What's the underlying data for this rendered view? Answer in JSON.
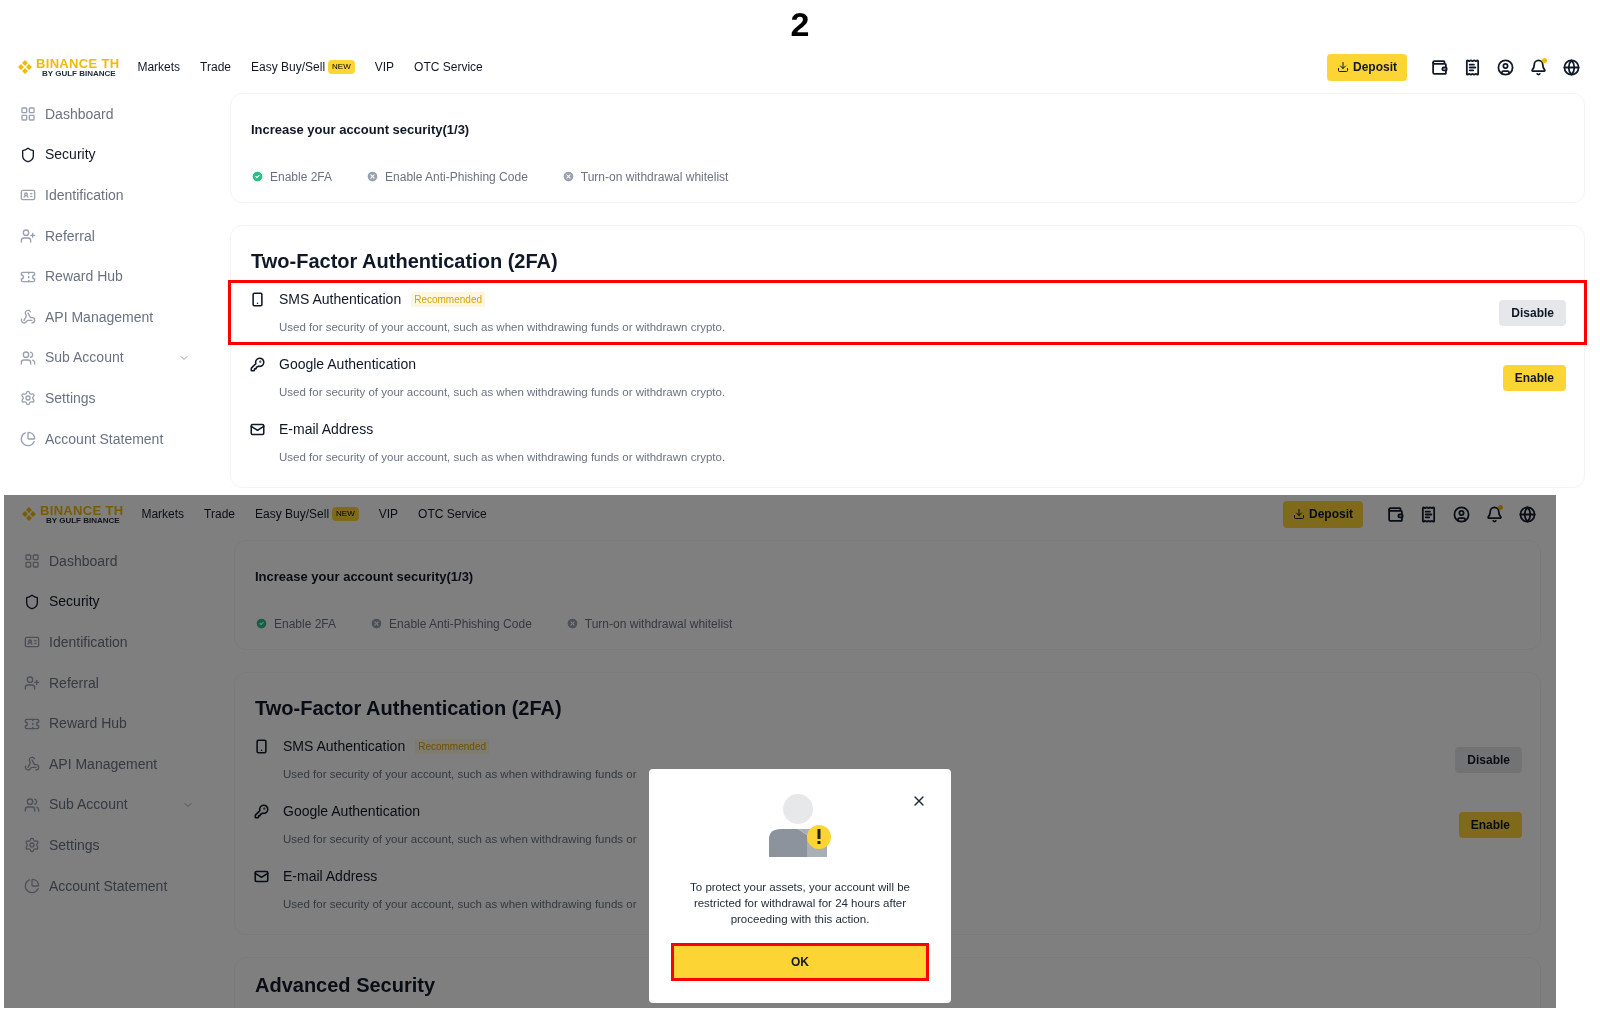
{
  "step_label": "2",
  "screens": [
    {
      "dimmed": false,
      "logo": {
        "name": "BINANCE TH",
        "sub": "BY GULF BINANCE"
      },
      "nav": [
        {
          "label": "Markets"
        },
        {
          "label": "Trade"
        },
        {
          "label": "Easy Buy/Sell",
          "badge": "NEW"
        },
        {
          "label": "VIP"
        },
        {
          "label": "OTC Service"
        }
      ],
      "deposit": "Deposit",
      "sidebar": [
        {
          "label": "Dashboard",
          "selected": false,
          "submenu": false
        },
        {
          "label": "Security",
          "selected": true,
          "submenu": false
        },
        {
          "label": "Identification",
          "selected": false,
          "submenu": false
        },
        {
          "label": "Referral",
          "selected": false,
          "submenu": false
        },
        {
          "label": "Reward Hub",
          "selected": false,
          "submenu": false
        },
        {
          "label": "API Management",
          "selected": false,
          "submenu": false
        },
        {
          "label": "Sub Account",
          "selected": false,
          "submenu": true
        },
        {
          "label": "Settings",
          "selected": false,
          "submenu": false
        },
        {
          "label": "Account Statement",
          "selected": false,
          "submenu": false
        }
      ],
      "security": {
        "title": "Increase your account security(1/3)",
        "steps": [
          {
            "label": "Enable 2FA",
            "done": true
          },
          {
            "label": "Enable Anti-Phishing Code",
            "done": false
          },
          {
            "label": "Turn-on withdrawal whitelist",
            "done": false
          }
        ]
      },
      "twofa": {
        "title": "Two-Factor Authentication (2FA)",
        "rows": [
          {
            "title": "SMS Authentication",
            "badge": "Recommended",
            "description": "Used for security of your account, such as when withdrawing funds or withdrawn crypto.",
            "button": {
              "label": "Disable",
              "kind": "secondary"
            },
            "highlighted": true
          },
          {
            "title": "Google Authentication",
            "description": "Used for security of your account, such as when withdrawing funds or withdrawn crypto.",
            "button": {
              "label": "Enable",
              "kind": "primary"
            },
            "highlighted": false
          },
          {
            "title": "E-mail Address",
            "description": "Used for security of your account, such as when withdrawing funds or withdrawn crypto.",
            "highlighted": false
          }
        ]
      }
    },
    {
      "dimmed": true,
      "logo": {
        "name": "BINANCE TH",
        "sub": "BY GULF BINANCE"
      },
      "nav": [
        {
          "label": "Markets"
        },
        {
          "label": "Trade"
        },
        {
          "label": "Easy Buy/Sell",
          "badge": "NEW"
        },
        {
          "label": "VIP"
        },
        {
          "label": "OTC Service"
        }
      ],
      "deposit": "Deposit",
      "sidebar": [
        {
          "label": "Dashboard",
          "selected": false,
          "submenu": false
        },
        {
          "label": "Security",
          "selected": true,
          "submenu": false
        },
        {
          "label": "Identification",
          "selected": false,
          "submenu": false
        },
        {
          "label": "Referral",
          "selected": false,
          "submenu": false
        },
        {
          "label": "Reward Hub",
          "selected": false,
          "submenu": false
        },
        {
          "label": "API Management",
          "selected": false,
          "submenu": false
        },
        {
          "label": "Sub Account",
          "selected": false,
          "submenu": true
        },
        {
          "label": "Settings",
          "selected": false,
          "submenu": false
        },
        {
          "label": "Account Statement",
          "selected": false,
          "submenu": false
        }
      ],
      "security": {
        "title": "Increase your account security(1/3)",
        "steps": [
          {
            "label": "Enable 2FA",
            "done": true
          },
          {
            "label": "Enable Anti-Phishing Code",
            "done": false
          },
          {
            "label": "Turn-on withdrawal whitelist",
            "done": false
          }
        ]
      },
      "twofa": {
        "title": "Two-Factor Authentication (2FA)",
        "rows": [
          {
            "title": "SMS Authentication",
            "badge": "Recommended",
            "description": "Used for security of your account, such as when withdrawing funds or",
            "button": {
              "label": "Disable",
              "kind": "secondary"
            },
            "highlighted": false
          },
          {
            "title": "Google Authentication",
            "description": "Used for security of your account, such as when withdrawing funds or",
            "button": {
              "label": "Enable",
              "kind": "primary"
            },
            "highlighted": false
          },
          {
            "title": "E-mail Address",
            "description": "Used for security of your account, such as when withdrawing funds or",
            "highlighted": false
          }
        ]
      },
      "advanced_title": "Advanced Security",
      "modal": {
        "message": "To protect your assets, your account will be restricted for withdrawal for 24 hours after proceeding with this action.",
        "ok": "OK",
        "ok_highlighted": true
      }
    }
  ]
}
